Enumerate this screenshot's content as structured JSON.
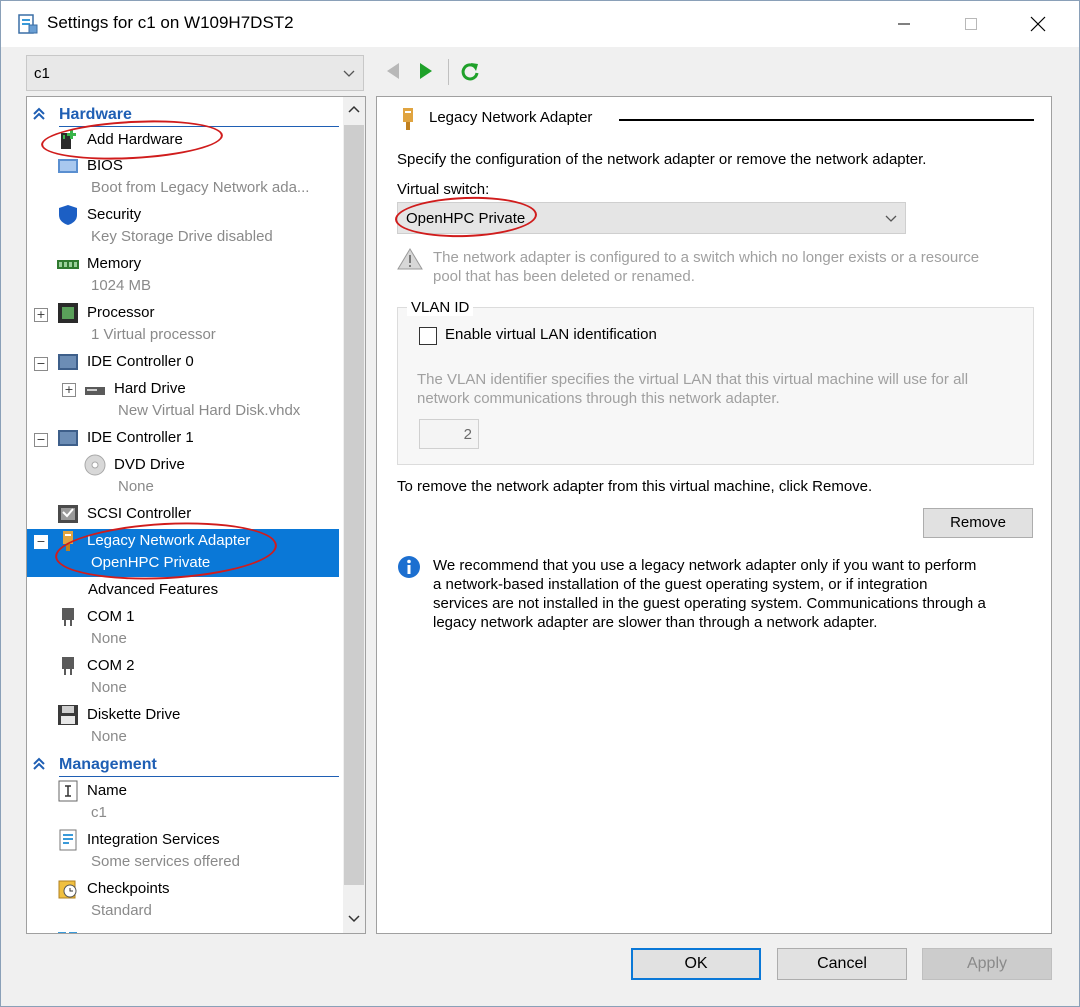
{
  "window": {
    "title": "Settings for c1 on W109H7DST2"
  },
  "vm_selector": {
    "value": "c1"
  },
  "tree": {
    "hardware_label": "Hardware",
    "management_label": "Management",
    "items": [
      {
        "key": "add_hardware",
        "label": "Add Hardware",
        "sub": ""
      },
      {
        "key": "bios",
        "label": "BIOS",
        "sub": "Boot from Legacy Network ada..."
      },
      {
        "key": "security",
        "label": "Security",
        "sub": "Key Storage Drive disabled"
      },
      {
        "key": "memory",
        "label": "Memory",
        "sub": "1024 MB"
      },
      {
        "key": "processor",
        "label": "Processor",
        "sub": "1 Virtual processor"
      },
      {
        "key": "ide0",
        "label": "IDE Controller 0",
        "sub": ""
      },
      {
        "key": "hard_drive",
        "label": "Hard Drive",
        "sub": "New Virtual Hard Disk.vhdx"
      },
      {
        "key": "ide1",
        "label": "IDE Controller 1",
        "sub": ""
      },
      {
        "key": "dvd",
        "label": "DVD Drive",
        "sub": "None"
      },
      {
        "key": "scsi",
        "label": "SCSI Controller",
        "sub": ""
      },
      {
        "key": "legacy_nic",
        "label": "Legacy Network Adapter",
        "sub": "OpenHPC Private"
      },
      {
        "key": "advanced",
        "label": "Advanced Features",
        "sub": ""
      },
      {
        "key": "com1",
        "label": "COM 1",
        "sub": "None"
      },
      {
        "key": "com2",
        "label": "COM 2",
        "sub": "None"
      },
      {
        "key": "diskette",
        "label": "Diskette Drive",
        "sub": "None"
      },
      {
        "key": "name",
        "label": "Name",
        "sub": "c1"
      },
      {
        "key": "integration",
        "label": "Integration Services",
        "sub": "Some services offered"
      },
      {
        "key": "checkpoints",
        "label": "Checkpoints",
        "sub": "Standard"
      }
    ],
    "selected": "legacy_nic"
  },
  "panel": {
    "title": "Legacy Network Adapter",
    "intro": "Specify the configuration of the network adapter or remove the network adapter.",
    "virtual_switch_label": "Virtual switch:",
    "virtual_switch_value": "OpenHPC Private",
    "warning_line1": "The network adapter is configured to a switch which no longer exists or a resource",
    "warning_line2": "pool that has been deleted or renamed.",
    "vlan_group_label": "VLAN ID",
    "vlan_checkbox_label": "Enable virtual LAN identification",
    "vlan_checked": false,
    "vlan_desc_line1": "The VLAN identifier specifies the virtual LAN that this virtual machine will use for all",
    "vlan_desc_line2": "network communications through this network adapter.",
    "vlan_value": "2",
    "remove_text": "To remove the network adapter from this virtual machine, click Remove.",
    "remove_button": "Remove",
    "info_line1": "We recommend that you use a legacy network adapter only if you want to perform",
    "info_line2": "a network-based installation of the guest operating system, or if integration",
    "info_line3": "services are not installed in the guest operating system. Communications through a",
    "info_line4": "legacy network adapter are slower than through a network adapter."
  },
  "buttons": {
    "ok": "OK",
    "cancel": "Cancel",
    "apply": "Apply"
  },
  "colors": {
    "accent": "#0a78d7",
    "section": "#1f5fb4",
    "annotation": "#d01c1c"
  },
  "icons": {
    "back": "back-arrow-icon",
    "forward": "forward-arrow-icon",
    "refresh": "refresh-icon",
    "warning": "warning-icon",
    "info": "info-icon"
  }
}
